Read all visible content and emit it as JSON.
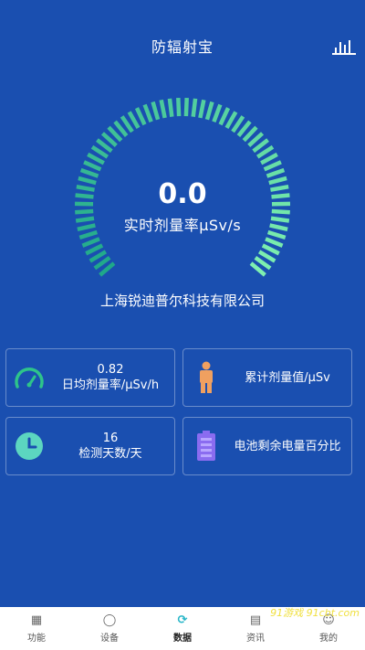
{
  "header": {
    "title": "防辐射宝",
    "chart_icon": "bar-chart-icon"
  },
  "gauge": {
    "value": "0.0",
    "label": "实时剂量率µSv/s",
    "colors": {
      "start": "#1fa88a",
      "end": "#7ff0b0"
    }
  },
  "company": "上海锐迪普尔科技有限公司",
  "cards": [
    {
      "icon": "speedometer-icon",
      "value": "0.82",
      "label": "日均剂量率/µSv/h"
    },
    {
      "icon": "person-icon",
      "value": "",
      "label": "累计剂量值/µSv"
    },
    {
      "icon": "clock-icon",
      "value": "16",
      "label": "检测天数/天"
    },
    {
      "icon": "battery-icon",
      "value": "",
      "label": "电池剩余电量百分比"
    }
  ],
  "tabs": [
    {
      "label": "功能",
      "icon": "grid-icon",
      "active": false
    },
    {
      "label": "设备",
      "icon": "shield-icon",
      "active": false
    },
    {
      "label": "数据",
      "icon": "refresh-icon",
      "active": true
    },
    {
      "label": "资讯",
      "icon": "news-icon",
      "active": false
    },
    {
      "label": "我的",
      "icon": "user-icon",
      "active": false
    }
  ],
  "watermark": "91游戏 91cbt.com"
}
